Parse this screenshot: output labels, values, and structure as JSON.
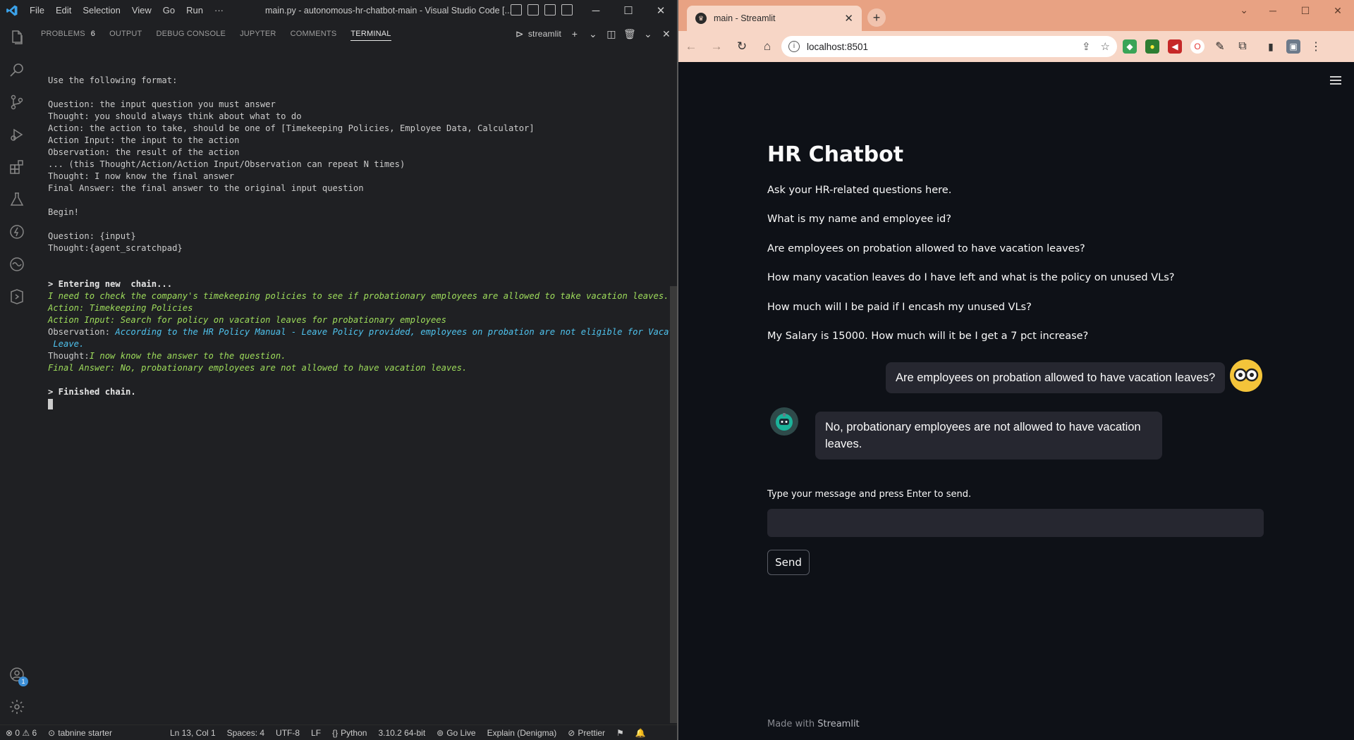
{
  "vscode": {
    "menu": [
      "File",
      "Edit",
      "Selection",
      "View",
      "Go",
      "Run",
      "···"
    ],
    "window_title": "main.py - autonomous-hr-chatbot-main - Visual Studio Code [...",
    "panel_tabs": [
      {
        "label": "PROBLEMS",
        "count": "6"
      },
      {
        "label": "OUTPUT"
      },
      {
        "label": "DEBUG CONSOLE"
      },
      {
        "label": "JUPYTER"
      },
      {
        "label": "COMMENTS"
      },
      {
        "label": "TERMINAL"
      }
    ],
    "terminal_name": "streamlit",
    "account_badge": "1",
    "terminal_lines": [
      {
        "style": "plain",
        "text": "Use the following format:"
      },
      {
        "style": "plain",
        "text": ""
      },
      {
        "style": "plain",
        "text": "Question: the input question you must answer"
      },
      {
        "style": "plain",
        "text": "Thought: you should always think about what to do"
      },
      {
        "style": "plain",
        "text": "Action: the action to take, should be one of [Timekeeping Policies, Employee Data, Calculator]"
      },
      {
        "style": "plain",
        "text": "Action Input: the input to the action"
      },
      {
        "style": "plain",
        "text": "Observation: the result of the action"
      },
      {
        "style": "plain",
        "text": "... (this Thought/Action/Action Input/Observation can repeat N times)"
      },
      {
        "style": "plain",
        "text": "Thought: I now know the final answer"
      },
      {
        "style": "plain",
        "text": "Final Answer: the final answer to the original input question"
      },
      {
        "style": "plain",
        "text": ""
      },
      {
        "style": "plain",
        "text": "Begin!"
      },
      {
        "style": "plain",
        "text": ""
      },
      {
        "style": "plain",
        "text": "Question: {input}"
      },
      {
        "style": "plain",
        "text": "Thought:{agent_scratchpad}"
      },
      {
        "style": "plain",
        "text": ""
      },
      {
        "style": "plain",
        "text": ""
      },
      {
        "style": "bold",
        "text": "> Entering new  chain..."
      },
      {
        "style": "green",
        "text": "I need to check the company's timekeeping policies to see if probationary employees are allowed to take vacation leaves."
      },
      {
        "style": "green",
        "text": "Action: Timekeeping Policies"
      },
      {
        "style": "green",
        "text": "Action Input: Search for policy on vacation leaves for probationary employees"
      },
      {
        "style": "obs",
        "prefix": "Observation: ",
        "text": "According to the HR Policy Manual - Leave Policy provided, employees on probation are not eligible for Vacation"
      },
      {
        "style": "cyan",
        "text": " Leave."
      },
      {
        "style": "thought",
        "prefix": "Thought:",
        "text": "I now know the answer to the question."
      },
      {
        "style": "green",
        "text": "Final Answer: No, probationary employees are not allowed to have vacation leaves."
      },
      {
        "style": "plain",
        "text": ""
      },
      {
        "style": "bold",
        "text": "> Finished chain."
      }
    ],
    "status": {
      "problems": "⊗ 0 ⚠ 6",
      "tabnine": "tabnine starter",
      "position": "Ln 13, Col 1",
      "spaces": "Spaces: 4",
      "encoding": "UTF-8",
      "eol": "LF",
      "language": "Python",
      "interpreter": "3.10.2 64-bit",
      "golive": "Go Live",
      "explain": "Explain (Denigma)",
      "prettier": "Prettier"
    }
  },
  "chrome": {
    "tab_title": "main - Streamlit",
    "url": "localhost:8501",
    "accent": "#e8a283"
  },
  "streamlit": {
    "title": "HR Chatbot",
    "intro": "Ask your HR-related questions here.",
    "examples": [
      "What is my name and employee id?",
      "Are employees on probation allowed to have vacation leaves?",
      "How many vacation leaves do I have left and what is the policy on unused VLs?",
      "How much will I be paid if I encash my unused VLs?",
      "My Salary is 15000. How much will it be I get a 7 pct increase?"
    ],
    "user_message": "Are employees on probation allowed to have vacation leaves?",
    "bot_message": "No, probationary employees are not allowed to have vacation leaves.",
    "input_label": "Type your message and press Enter to send.",
    "input_value": "",
    "send_label": "Send",
    "footer_prefix": "Made with",
    "footer_brand": "Streamlit"
  }
}
